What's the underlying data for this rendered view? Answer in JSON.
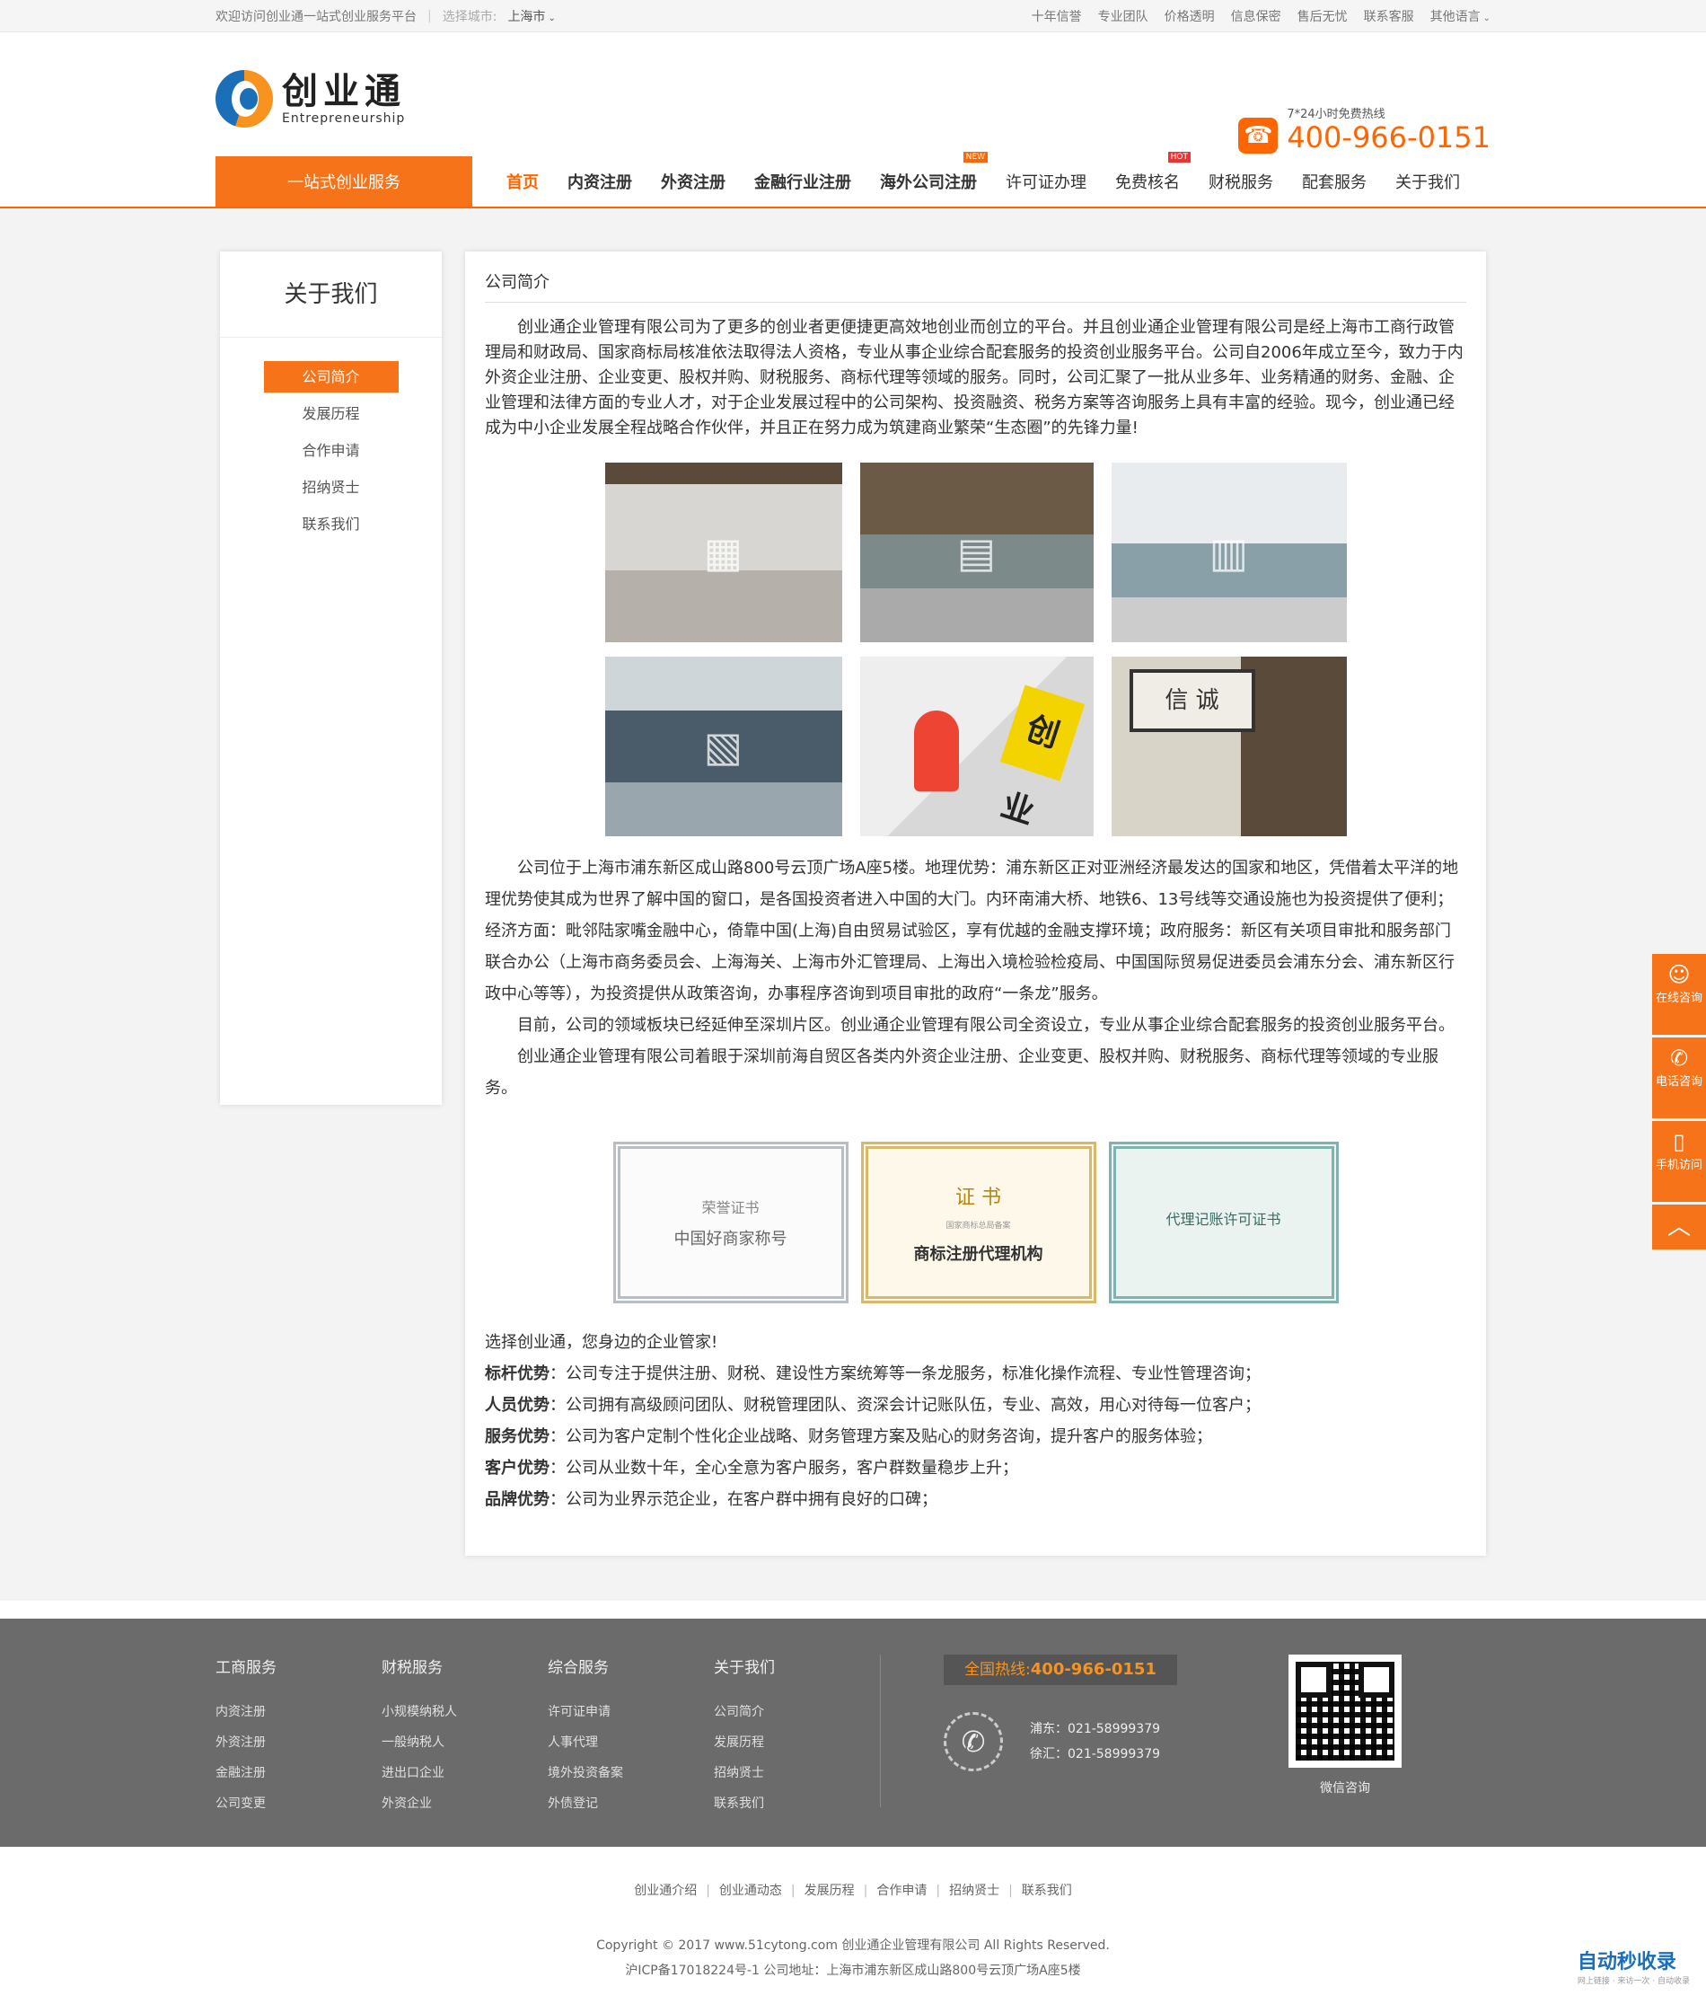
{
  "topbar": {
    "welcome": "欢迎访问创业通一站式创业服务平台",
    "city_label": "选择城市:",
    "city": "上海市",
    "links": [
      "十年信誉",
      "专业团队",
      "价格透明",
      "信息保密",
      "售后无忧",
      "联系客服",
      "其他语言"
    ]
  },
  "header": {
    "logo_cn": "创业通",
    "logo_en": "Entrepreneurship",
    "hotline_label": "7*24小时免费热线",
    "hotline_number": "400-966-0151"
  },
  "nav": {
    "category": "一站式创业服务",
    "items": [
      "首页",
      "内资注册",
      "外资注册",
      "金融行业注册",
      "海外公司注册",
      "许可证办理",
      "免费核名",
      "财税服务",
      "配套服务",
      "关于我们"
    ],
    "badge_new": "NEW",
    "badge_hot": "HOT"
  },
  "sidebar": {
    "title": "关于我们",
    "items": [
      "公司简介",
      "发展历程",
      "合作申请",
      "招纳贤士",
      "联系我们"
    ]
  },
  "content": {
    "title": "公司简介",
    "intro": "创业通企业管理有限公司为了更多的创业者更便捷更高效地创业而创立的平台。并且创业通企业管理有限公司是经上海市工商行政管理局和财政局、国家商标局核准依法取得法人资格，专业从事企业综合配套服务的投资创业服务平台。公司自2006年成立至今，致力于内外资企业注册、企业变更、股权并购、财税服务、商标代理等领域的服务。同时，公司汇聚了一批从业多年、业务精通的财务、金融、企业管理和法律方面的专业人才，对于企业发展过程中的公司架构、投资融资、税务方案等咨询服务上具有丰富的经验。现今，创业通已经成为中小企业发展全程战略合作伙伴，并且正在努力成为筑建商业繁荣“生态圈”的先锋力量!",
    "photo_sign_text": "创业",
    "photo_calligraphy_text": "信 诚",
    "location": "公司位于上海市浦东新区成山路800号云顶广场A座5楼。地理优势：浦东新区正对亚洲经济最发达的国家和地区，凭借着太平洋的地理优势使其成为世界了解中国的窗口，是各国投资者进入中国的大门。内环南浦大桥、地铁6、13号线等交通设施也为投资提供了便利；经济方面：毗邻陆家嘴金融中心，倚靠中国(上海)自由贸易试验区，享有优越的金融支撑环境；政府服务：新区有关项目审批和服务部门联合办公（上海市商务委员会、上海海关、上海市外汇管理局、上海出入境检验检疫局、中国国际贸易促进委员会浦东分会、浦东新区行政中心等等），为投资提供从政策咨询，办事程序咨询到项目审批的政府“一条龙”服务。",
    "shenzhen": "目前，公司的领域板块已经延伸至深圳片区。创业通企业管理有限公司全资设立，专业从事企业综合配套服务的投资创业服务平台。",
    "qianhai": "创业通企业管理有限公司着眼于深圳前海自贸区各类内外资企业注册、企业变更、股权并购、财税服务、商标代理等领域的专业服务。",
    "certificates": [
      {
        "title": "荣誉证书",
        "name": "中国好商家称号"
      },
      {
        "title": "证 书",
        "name": "商标注册代理机构",
        "sub": "国家商标总局备案"
      },
      {
        "title": "代理记账许可证书",
        "name": ""
      }
    ],
    "choose": "选择创业通，您身边的企业管家!",
    "advantages": [
      {
        "label": "标杆优势",
        "text": "：公司专注于提供注册、财税、建设性方案统筹等一条龙服务，标准化操作流程、专业性管理咨询；"
      },
      {
        "label": "人员优势",
        "text": "：公司拥有高级顾问团队、财税管理团队、资深会计记账队伍，专业、高效，用心对待每一位客户；"
      },
      {
        "label": "服务优势",
        "text": "：公司为客户定制个性化企业战略、财务管理方案及贴心的财务咨询，提升客户的服务体验；"
      },
      {
        "label": "客户优势",
        "text": "：公司从业数十年，全心全意为客户服务，客户群数量稳步上升；"
      },
      {
        "label": "品牌优势",
        "text": "：公司为业界示范企业，在客户群中拥有良好的口碑；"
      }
    ]
  },
  "float_tools": [
    {
      "label": "在线咨询",
      "icon": "chat-icon"
    },
    {
      "label": "电话咨询",
      "icon": "phone-icon"
    },
    {
      "label": "手机访问",
      "icon": "mobile-icon"
    }
  ],
  "footer": {
    "columns": [
      {
        "title": "工商服务",
        "items": [
          "内资注册",
          "外资注册",
          "金融注册",
          "公司变更"
        ]
      },
      {
        "title": "财税服务",
        "items": [
          "小规模纳税人",
          "一般纳税人",
          "进出口企业",
          "外资企业"
        ]
      },
      {
        "title": "综合服务",
        "items": [
          "许可证申请",
          "人事代理",
          "境外投资备案",
          "外债登记"
        ]
      },
      {
        "title": "关于我们",
        "items": [
          "公司简介",
          "发展历程",
          "招纳贤士",
          "联系我们"
        ]
      }
    ],
    "hotline_label": "全国热线:",
    "hotline": "400-966-0151",
    "tel_pudong": "浦东：021-58999379",
    "tel_xuhui": "徐汇：021-58999379",
    "qr_caption": "微信咨询"
  },
  "bottom": {
    "links": [
      "创业通介绍",
      "创业通动态",
      "发展历程",
      "合作申请",
      "招纳贤士",
      "联系我们"
    ],
    "copyright": "Copyright © 2017 www.51cytong.com 创业通企业管理有限公司 All Rights Reserved.",
    "icp": "沪ICP备17018224号-1 公司地址：上海市浦东新区成山路800号云顶广场A座5楼",
    "watermark": "自动秒收录",
    "watermark_sub": "网上链接 · 来访一次 · 自动收录"
  }
}
